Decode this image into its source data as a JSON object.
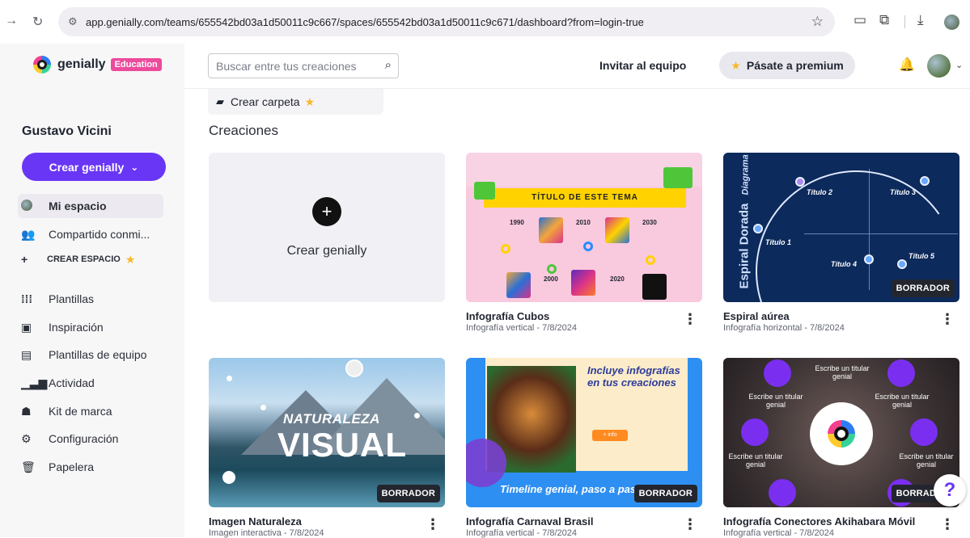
{
  "browser": {
    "url": "app.genially.com/teams/655542bd03a1d50011c9c667/spaces/655542bd03a1d50011c9c671/dashboard?from=login-true",
    "icons": [
      "forward-icon",
      "reload-icon",
      "tune-icon",
      "bookmark-star-icon",
      "reading-list-icon",
      "extensions-icon",
      "download-icon",
      "profile-icon"
    ]
  },
  "brand": {
    "name": "genially",
    "badge": "Education",
    "accent": "#6a36f5",
    "badge_color": "#ec4b9c"
  },
  "sidebar": {
    "user_name": "Gustavo Vicini",
    "create_label": "Crear genially",
    "items": [
      {
        "label": "Mi espacio",
        "icon": "globe-icon",
        "active": true
      },
      {
        "label": "Compartido conmi...",
        "icon": "people-icon"
      },
      {
        "label": "CREAR ESPACIO",
        "icon": "plus-icon"
      },
      {
        "label": "Plantillas",
        "icon": "grid-icon"
      },
      {
        "label": "Inspiración",
        "icon": "inspiration-icon"
      },
      {
        "label": "Plantillas de equipo",
        "icon": "team-templates-icon"
      },
      {
        "label": "Actividad",
        "icon": "bar-chart-icon"
      },
      {
        "label": "Kit de marca",
        "icon": "brand-kit-icon"
      },
      {
        "label": "Configuración",
        "icon": "gear-icon"
      },
      {
        "label": "Papelera",
        "icon": "trash-icon"
      }
    ]
  },
  "topbar": {
    "search_placeholder": "Buscar entre tus creaciones",
    "invite_label": "Invitar al equipo",
    "premium_label": "Pásate a premium"
  },
  "main": {
    "folder_label": "Crear carpeta",
    "section_title": "Creaciones",
    "new_card_label": "Crear genially",
    "draft_badge": "BORRADOR",
    "cards": [
      {
        "title": "Infografía Cubos",
        "subtitle": "Infografía vertical - 7/8/2024",
        "draft": false,
        "thumb_text": {
          "band": "TÍTULO DE ESTE TEMA",
          "years": [
            "1990",
            "2010",
            "2030",
            "2000",
            "2020"
          ]
        }
      },
      {
        "title": "Espiral aúrea",
        "subtitle": "Infografía horizontal - 7/8/2024",
        "draft": true,
        "thumb_text": {
          "vertical": "Espiral Dorada",
          "vertical_sub": "Diagrama",
          "titles": [
            "Título 1",
            "Título 2",
            "Título 3",
            "Título 4",
            "Título 5"
          ]
        }
      },
      {
        "title": "Imagen Naturaleza",
        "subtitle": "Imagen interactiva - 7/8/2024",
        "draft": true,
        "thumb_text": {
          "line1": "NATURALEZA",
          "line2": "VISUAL"
        }
      },
      {
        "title": "Infografía Carnaval Brasil",
        "subtitle": "Infografía vertical - 7/8/2024",
        "draft": true,
        "thumb_text": {
          "heading": "Incluye infografías en tus creaciones",
          "info": "+ info",
          "footer": "Timeline genial, paso a paso"
        }
      },
      {
        "title": "Infografía Conectores Akihabara Móvil",
        "subtitle": "Infografía vertical - 7/8/2024",
        "draft": true,
        "thumb_text": {
          "node_label": "Escribe un titular genial"
        }
      }
    ]
  },
  "help_label": "?"
}
